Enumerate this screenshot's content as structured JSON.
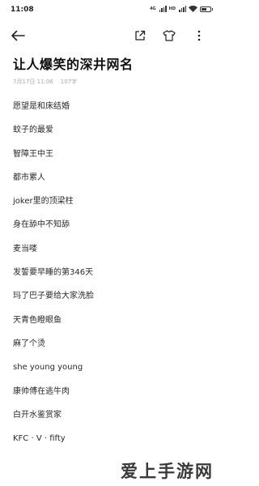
{
  "status_bar": {
    "time": "11:08",
    "signal_1_label": "4G",
    "signal_2_label": "HD",
    "battery_level": 0.6
  },
  "toolbar": {
    "back_icon": "arrow-left-icon",
    "share_icon": "share-icon",
    "skin_icon": "tshirt-icon",
    "more_icon": "more-vertical-icon"
  },
  "note": {
    "title": "让人爆笑的深井网名",
    "date": "7月17日 11:06",
    "word_count": "107字",
    "items": [
      "愿望是和床结婚",
      "蚊子的最爱",
      "智障王中王",
      "都市累人",
      "joker里的顶梁柱",
      "身在舔中不知舔",
      "麦当喽",
      "发誓要早睡的第346天",
      "玛了巴子要给大家洗脸",
      "天青色瞪眼鱼",
      "麻了个烫",
      "she young young",
      "康帅傅在逃牛肉",
      "白开水鉴赏家",
      "KFC · V · fifty"
    ]
  },
  "watermark": "爱上手游网"
}
